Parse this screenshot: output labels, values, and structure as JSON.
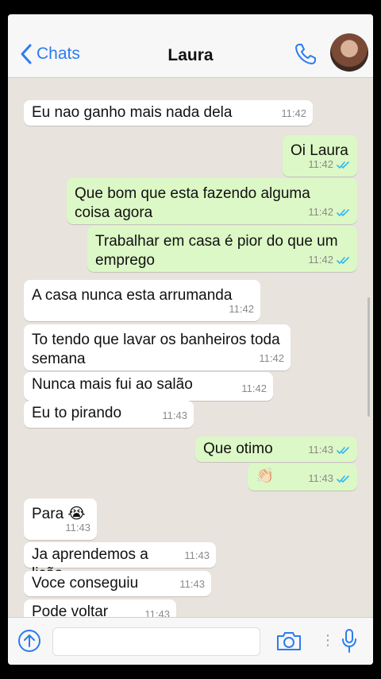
{
  "header": {
    "back_label": "Chats",
    "title": "Laura",
    "accent_color": "#2b7cf0"
  },
  "messages": [
    {
      "dir": "in",
      "text": "Eu nao ganho mais nada dela",
      "time": "11:42"
    },
    {
      "dir": "out",
      "text": "Oi Laura",
      "time": "11:42",
      "read": true
    },
    {
      "dir": "out",
      "text": "Que bom que esta fazendo alguma coisa agora",
      "time": "11:42",
      "read": true
    },
    {
      "dir": "out",
      "text": "Trabalhar em casa é pior do que um emprego",
      "time": "11:42",
      "read": true
    },
    {
      "dir": "in",
      "text": "A casa nunca esta arrumanda",
      "time": "11:42"
    },
    {
      "dir": "in",
      "text": "To tendo que lavar os banheiros toda semana",
      "time": "11:42"
    },
    {
      "dir": "in",
      "text": "Nunca mais fui ao salão",
      "time": "11:42"
    },
    {
      "dir": "in",
      "text": "Eu to pirando",
      "time": "11:43"
    },
    {
      "dir": "out",
      "text": "Que otimo",
      "time": "11:43",
      "read": true
    },
    {
      "dir": "out",
      "text": "👏🏻",
      "time": "11:43",
      "read": true
    },
    {
      "dir": "in",
      "text": "Para 😭",
      "time": "11:43"
    },
    {
      "dir": "in",
      "text": "Ja aprendemos a lição",
      "time": "11:43"
    },
    {
      "dir": "in",
      "text": "Voce conseguiu",
      "time": "11:43"
    },
    {
      "dir": "in",
      "text": "Pode voltar",
      "time": "11:43"
    }
  ],
  "input": {
    "value": ""
  },
  "colors": {
    "incoming_bubble": "#ffffff",
    "outgoing_bubble": "#dcf8c6",
    "chat_background": "#e8e3dd",
    "read_ticks": "#34b7f1"
  }
}
